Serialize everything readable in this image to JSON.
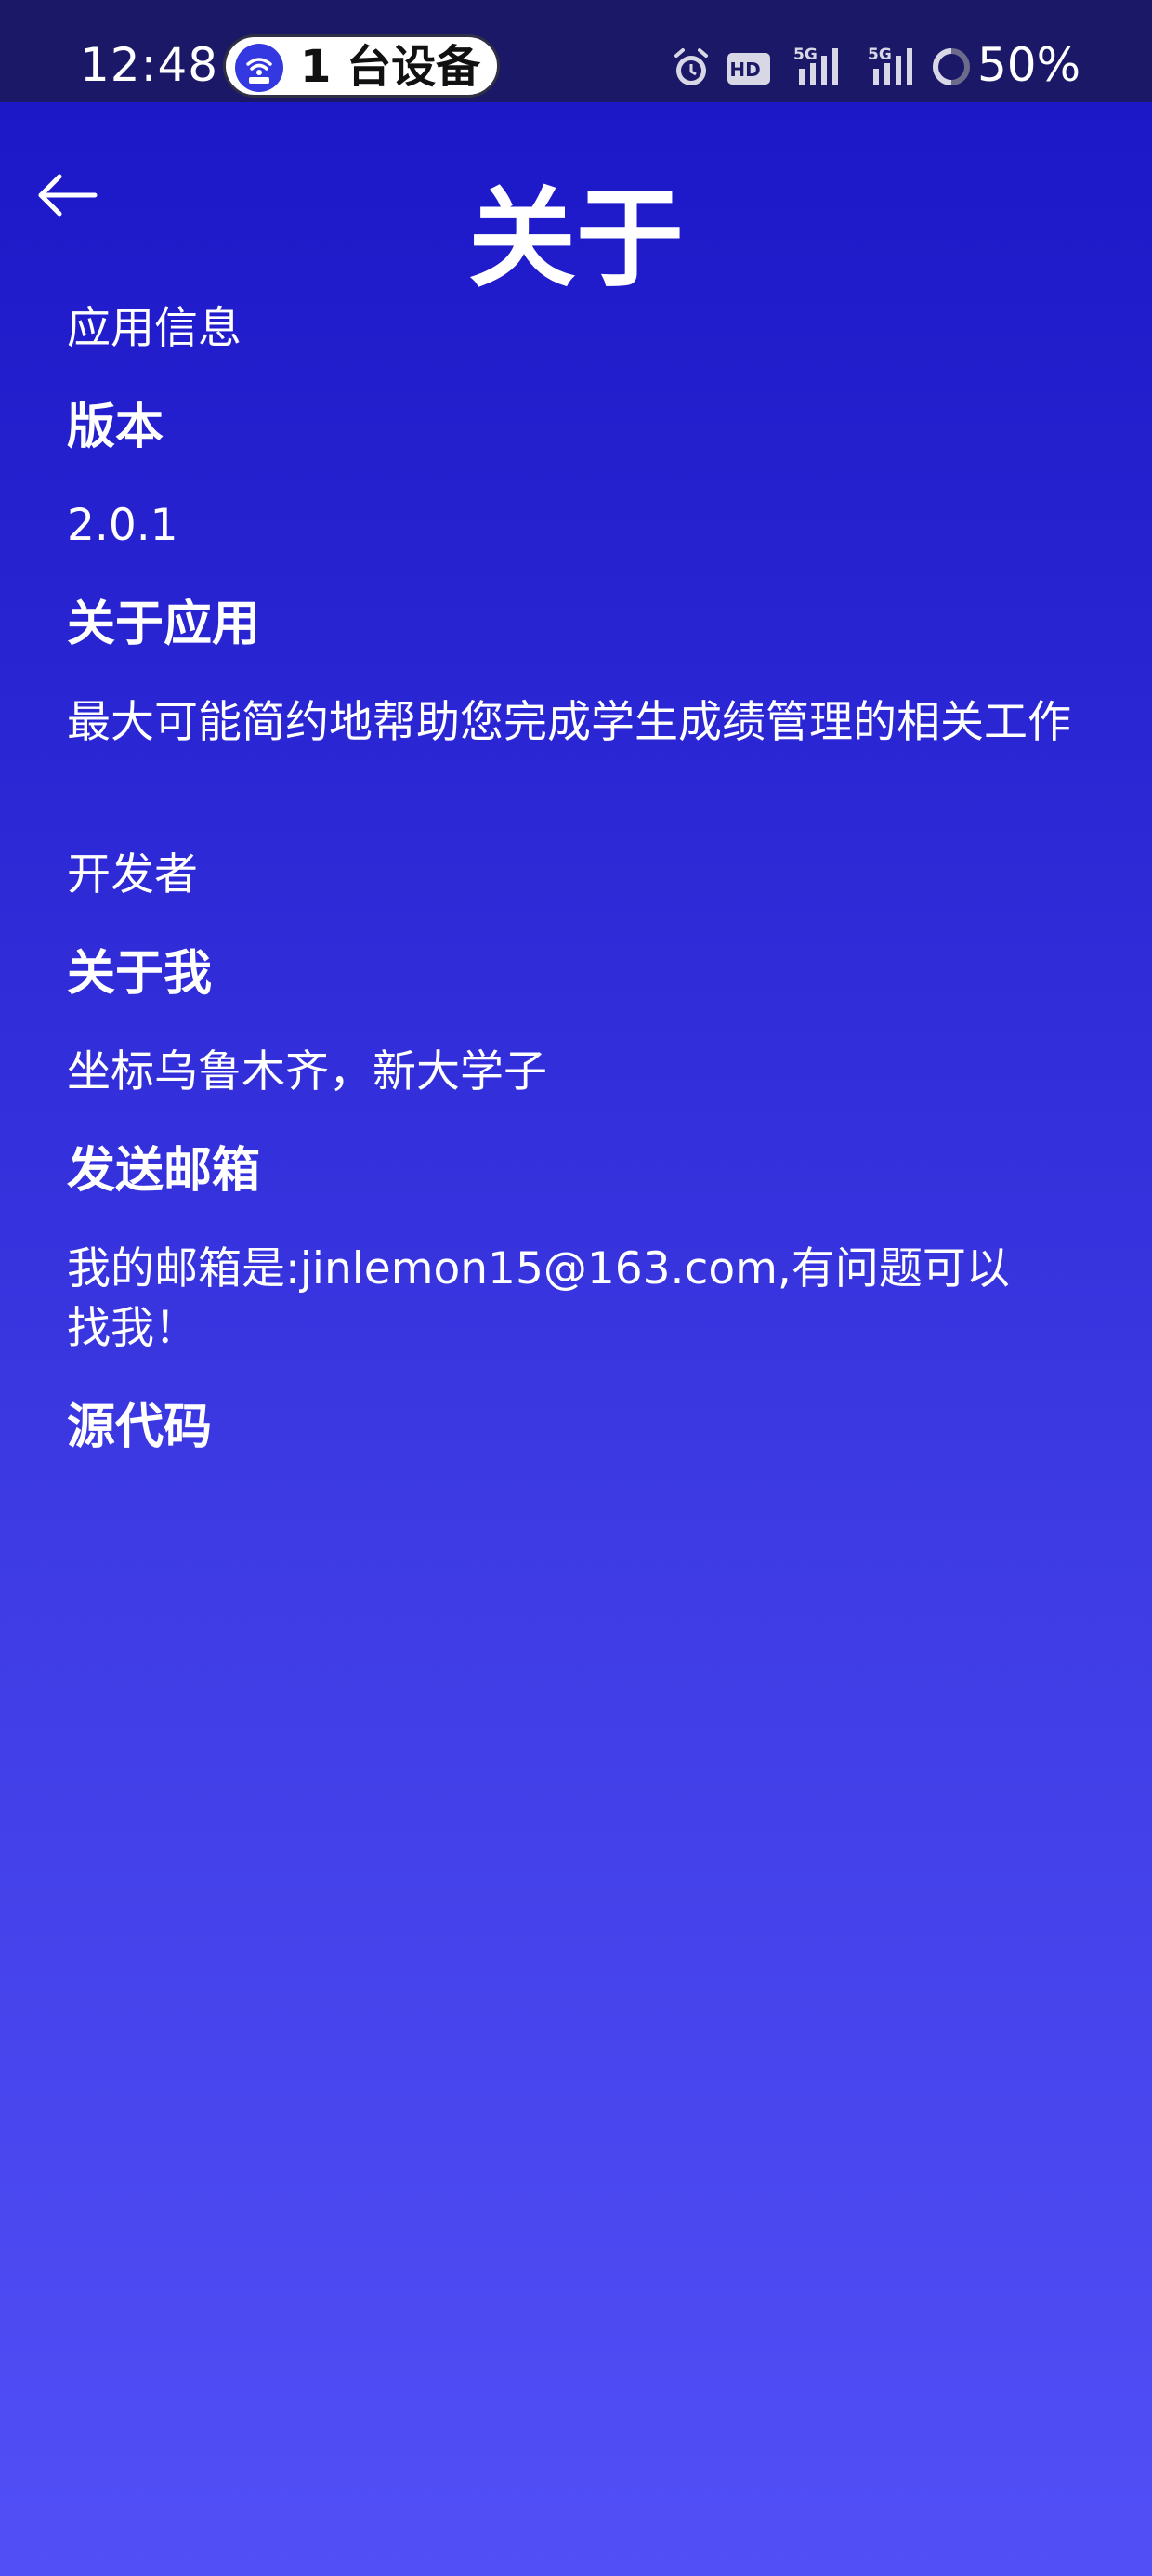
{
  "status_bar": {
    "time": "12:48",
    "hotspot_label": "1 台设备",
    "network_hd": "HD",
    "network_1": "5G",
    "network_2": "5G",
    "battery": "50%"
  },
  "app_bar": {
    "title": "关于",
    "back_icon": "arrow-left-icon"
  },
  "sections": {
    "app_info_label": "应用信息",
    "version_heading": "版本",
    "version_value": "2.0.1",
    "about_app_heading": "关于应用",
    "about_app_text": "最大可能简约地帮助您完成学生成绩管理的相关工作",
    "developer_label": "开发者",
    "about_me_heading": "关于我",
    "about_me_text": "坐标乌鲁木齐，新大学子",
    "send_email_heading": "发送邮箱",
    "email_text": "我的邮箱是:jinlemon15@163.com,有问题可以找我！",
    "source_code_heading": "源代码"
  },
  "colors": {
    "status_bar_bg": "#1c1868",
    "gradient_top": "#1a16c6",
    "gradient_bottom": "#524ff7",
    "text": "#ffffff"
  }
}
